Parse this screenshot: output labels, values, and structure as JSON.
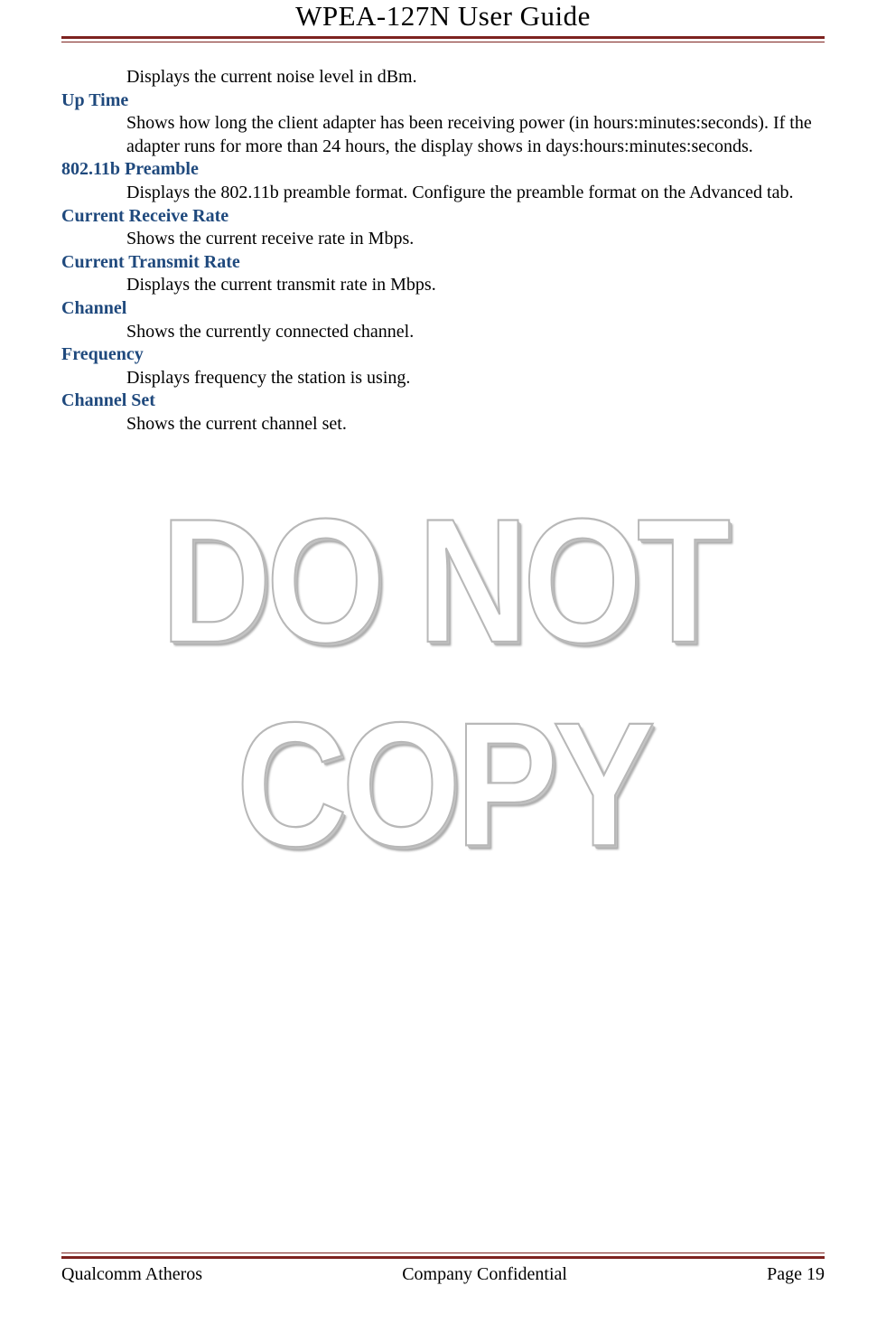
{
  "header": {
    "title": "WPEA-127N User Guide"
  },
  "content": {
    "first_body": "Displays the current noise level in dBm.",
    "items": [
      {
        "term": "Up Time",
        "body": "Shows how long the client adapter has been receiving power (in hours:minutes:seconds). If the adapter runs for more than 24 hours, the display shows in days:hours:minutes:seconds."
      },
      {
        "term": "802.11b Preamble",
        "body": "Displays the 802.11b preamble format. Configure the preamble format on the Advanced tab."
      },
      {
        "term": "Current Receive Rate",
        "body": "Shows the current receive rate in Mbps."
      },
      {
        "term": "Current Transmit Rate",
        "body": "Displays the current transmit rate in Mbps."
      },
      {
        "term": "Channel",
        "body": "Shows the currently connected channel."
      },
      {
        "term": "Frequency",
        "body": "Displays frequency the station is using."
      },
      {
        "term": "Channel Set",
        "body": "Shows the current channel set."
      }
    ]
  },
  "watermark": "DO NOT COPY",
  "footer": {
    "left": "Qualcomm Atheros",
    "center": "Company Confidential",
    "right": "Page 19"
  }
}
